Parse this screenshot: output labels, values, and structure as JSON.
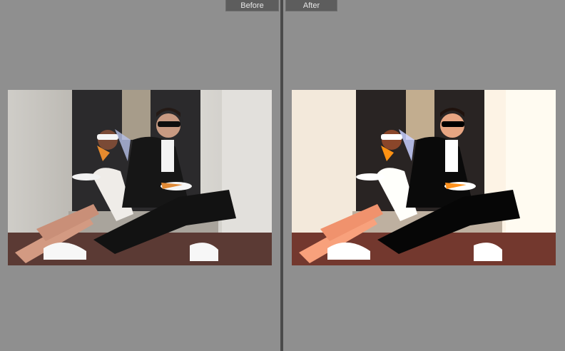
{
  "compare_view": {
    "before_label": "Before",
    "after_label": "After"
  },
  "colors": {
    "panel_bg": "#8f8f8f",
    "divider": "#4a4a4a",
    "label_bg": "#5d5d5d",
    "label_text": "#e6e6e6"
  },
  "photo": {
    "subject": "photo-couple-eating-pizza"
  }
}
